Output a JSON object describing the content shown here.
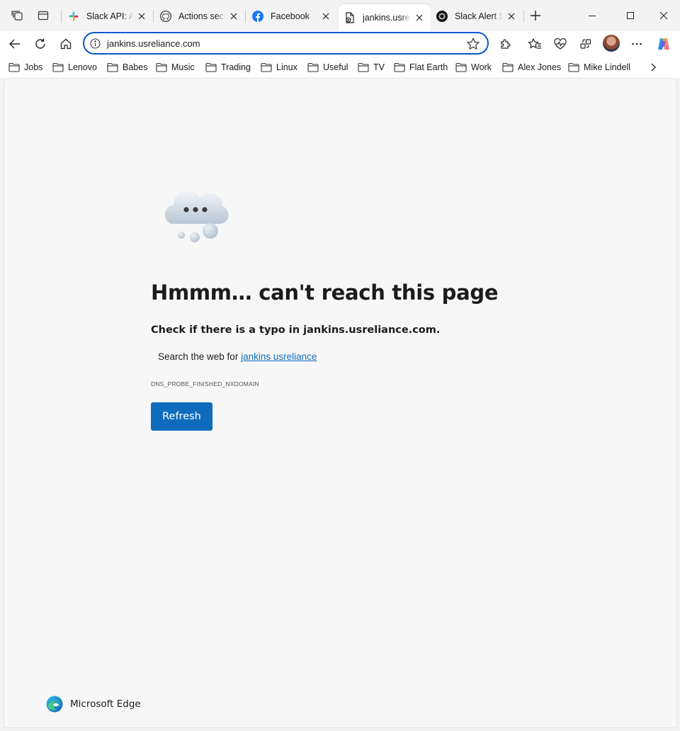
{
  "tabs": [
    {
      "title": "Slack API: Ap",
      "icon": "slack-icon"
    },
    {
      "title": "Actions secre",
      "icon": "github-icon"
    },
    {
      "title": "Facebook",
      "icon": "facebook-icon"
    },
    {
      "title": "jankins.usreli",
      "icon": "error-page-icon",
      "active": true
    },
    {
      "title": "Slack Alert Se",
      "icon": "chatgpt-icon"
    }
  ],
  "address": {
    "url": "jankins.usreliance.com"
  },
  "favorites": [
    "Jobs",
    "Lenovo",
    "Babes",
    "Music",
    "Trading",
    "Linux",
    "Useful",
    "TV",
    "Flat Earth",
    "Work",
    "Alex Jones",
    "Mike Lindell"
  ],
  "error": {
    "title": "Hmmm… can't reach this page",
    "hint": "Check if there is a typo in jankins.usreliance.com.",
    "search_prefix": "Search the web for ",
    "search_link": "jankins usreliance",
    "code": "DNS_PROBE_FINISHED_NXDOMAIN",
    "refresh_label": "Refresh"
  },
  "brand": {
    "name": "Microsoft Edge"
  },
  "colors": {
    "accent": "#0f6cbd",
    "address_border": "#0c59c7",
    "background": "#f7f7f7"
  }
}
